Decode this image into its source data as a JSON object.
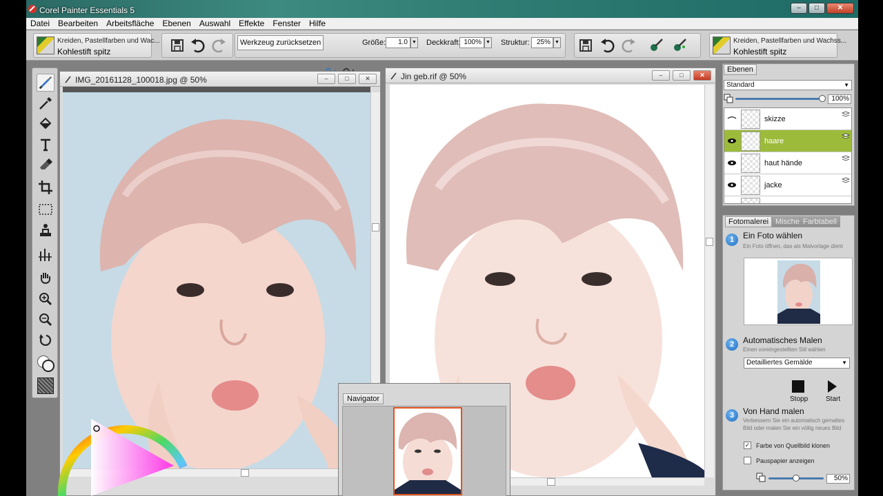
{
  "app": {
    "title": "Corel Painter Essentials 5",
    "window_buttons": [
      "–",
      "□",
      "✕"
    ]
  },
  "menu": [
    "Datei",
    "Bearbeiten",
    "Arbeitsfläche",
    "Ebenen",
    "Auswahl",
    "Effekte",
    "Fenster",
    "Hilfe"
  ],
  "property_bar": {
    "brush_category": "Kreiden, Pastellfarben und Wac...",
    "brush_variant": "Kohlestift spitz",
    "reset_tool_label": "Werkzeug zurücksetzen",
    "size_label": "Größe:",
    "size_value": "1.0",
    "opacity_label": "Deckkraft:",
    "opacity_value": "100%",
    "grain_label": "Struktur:",
    "grain_value": "25%"
  },
  "source_brush": {
    "brush_category": "Kreiden, Pastellfarben und Wachss...",
    "brush_variant": "Kohlestift spitz"
  },
  "doc_left": {
    "title": "IMG_20161128_100018.jpg @ 50%"
  },
  "doc_right": {
    "title": "Jin geb.rif @ 50%"
  },
  "navigator": {
    "tab": "Navigator"
  },
  "layers_panel": {
    "tab": "Ebenen",
    "composite_method": "Standard",
    "opacity": "100%",
    "layers": [
      {
        "name": "skizze",
        "visible": true,
        "selected": false
      },
      {
        "name": "haare",
        "visible": true,
        "selected": true
      },
      {
        "name": "haut hände",
        "visible": true,
        "selected": false
      },
      {
        "name": "jacke",
        "visible": true,
        "selected": false
      }
    ]
  },
  "photo_panel": {
    "tabs": [
      "Fotomalerei",
      "Mische",
      "Farbtabell"
    ],
    "step1_num": "1",
    "step1_title": "Ein Foto wählen",
    "step1_desc": "Ein Foto öffnen, das als Malvorlage dient",
    "step2_num": "2",
    "step2_title": "Automatisches Malen",
    "step2_desc": "Einen voreingestellten Stil wählen",
    "style_value": "Detailliertes Gemälde",
    "stop_label": "Stopp",
    "start_label": "Start",
    "step3_num": "3",
    "step3_title": "Von Hand malen",
    "step3_desc_line1": "Verbessern Sie ein automatisch gemaltes",
    "step3_desc_line2": "Bild oder malen Sie ein völlig neues Bild",
    "clone_label": "Farbe von Quellbild klonen",
    "clone_checked": true,
    "tracing_label": "Pauspapier anzeigen",
    "tracing_checked": false,
    "zoom_value": "50%"
  },
  "colors": {
    "layer_selected": "#9dbb3a",
    "titlebar": "#2f7d73",
    "navigator_frame": "#e2521c"
  }
}
